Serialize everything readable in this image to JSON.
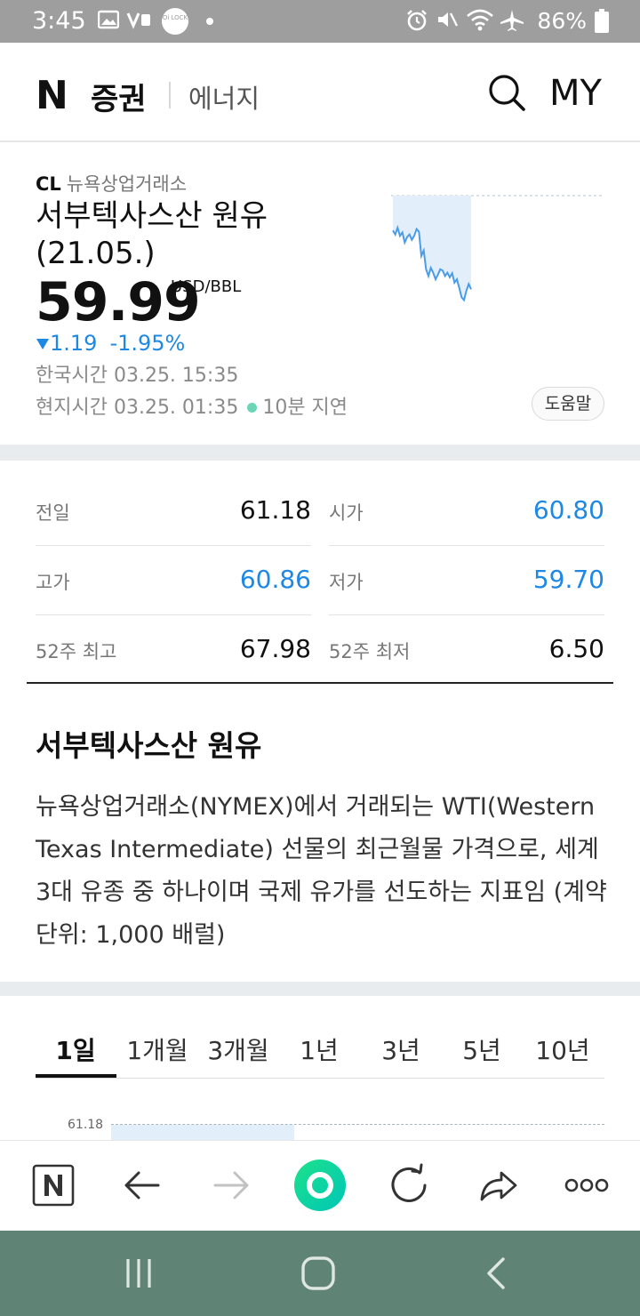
{
  "status_bar": {
    "time": "3:45",
    "battery": "86%",
    "icons": [
      "image-icon",
      "volte-icon",
      "lock-icon",
      "dot-icon",
      "alarm-icon",
      "mute-icon",
      "wifi-icon",
      "airplane-icon",
      "battery-icon"
    ],
    "lock_text": "Oi LOCK"
  },
  "header": {
    "logo": "N",
    "brand": "증권",
    "category": "에너지",
    "my_label": "MY"
  },
  "quote": {
    "code": "CL",
    "exchange": "뉴욕상업거래소",
    "name_line1": "서부텍사스산 원유",
    "name_line2": "(21.05.)",
    "price": "59.99",
    "unit": "USD/BBL",
    "change": "1.19",
    "change_pct": "-1.95%",
    "kr_time": "한국시간 03.25. 15:35",
    "local_time": "현지시간 03.25. 01:35",
    "delay": "10분 지연",
    "help": "도움말",
    "colors": {
      "down": "#1e88e5",
      "delay_dot": "#6bd6b5"
    }
  },
  "stats": [
    {
      "label": "전일",
      "value": "61.18",
      "blue": false
    },
    {
      "label": "시가",
      "value": "60.80",
      "blue": true
    },
    {
      "label": "고가",
      "value": "60.86",
      "blue": true
    },
    {
      "label": "저가",
      "value": "59.70",
      "blue": true
    },
    {
      "label": "52주 최고",
      "value": "67.98",
      "blue": false
    },
    {
      "label": "52주 최저",
      "value": "6.50",
      "blue": false
    }
  ],
  "description": {
    "title": "서부텍사스산 원유",
    "text": "뉴욕상업거래소(NYMEX)에서 거래되는 WTI(Western Texas Intermediate) 선물의 최근월물 가격으로, 세계 3대 유종 중 하나이며 국제 유가를 선도하는 지표임 (계약단위: 1,000 배럴)"
  },
  "tabs": [
    "1일",
    "1개월",
    "3개월",
    "1년",
    "3년",
    "5년",
    "10년"
  ],
  "active_tab": "1일",
  "chart_ref_label": "61.18",
  "chart_data": {
    "type": "area",
    "title": "",
    "reference": 61.18,
    "ylim": [
      59.6,
      61.3
    ],
    "values": [
      60.78,
      60.72,
      60.82,
      60.7,
      60.75,
      60.6,
      60.68,
      60.72,
      60.64,
      60.7,
      60.8,
      60.76,
      60.4,
      60.48,
      60.2,
      60.1,
      60.22,
      60.15,
      60.05,
      60.12,
      60.2,
      60.18,
      60.1,
      60.15,
      60.08,
      60.14,
      60.0,
      60.05,
      59.92,
      59.78,
      59.74,
      59.88,
      59.98,
      59.9
    ]
  },
  "bottom_nav": {
    "items": [
      "naver-home-icon",
      "back-icon",
      "forward-icon",
      "green-dot-icon",
      "refresh-icon",
      "share-icon",
      "more-icon"
    ]
  },
  "system_nav": [
    "recent-apps-icon",
    "home-icon",
    "back-icon"
  ]
}
